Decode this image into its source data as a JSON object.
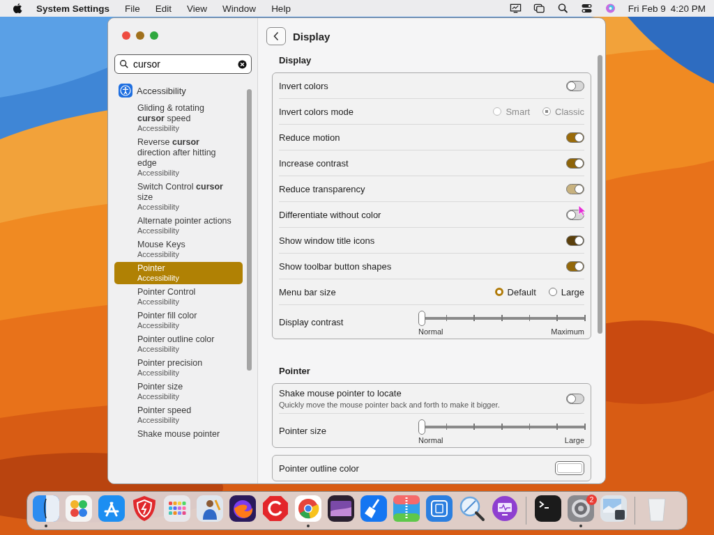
{
  "menu_bar": {
    "app": "System Settings",
    "menus": [
      "File",
      "Edit",
      "View",
      "Window",
      "Help"
    ],
    "date": "Fri Feb 9",
    "time": "4:20 PM"
  },
  "window": {
    "title": "Display",
    "search": {
      "value": "cursor"
    },
    "sidebar": {
      "items": [
        {
          "kind": "category",
          "title": "Accessibility",
          "selected": false
        },
        {
          "kind": "result",
          "title": "Gliding & rotating **cursor** speed",
          "subtitle": "Accessibility",
          "selected": false
        },
        {
          "kind": "result",
          "title": "Reverse **cursor** direction after hitting edge",
          "subtitle": "Accessibility",
          "selected": false
        },
        {
          "kind": "result",
          "title": "Switch Control **cursor** size",
          "subtitle": "Accessibility",
          "selected": false
        },
        {
          "kind": "result",
          "title": "Alternate pointer actions",
          "subtitle": "Accessibility",
          "selected": false
        },
        {
          "kind": "result",
          "title": "Mouse Keys",
          "subtitle": "Accessibility",
          "selected": false
        },
        {
          "kind": "result",
          "title": "Pointer",
          "subtitle": "Accessibility",
          "selected": true
        },
        {
          "kind": "result",
          "title": "Pointer Control",
          "subtitle": "Accessibility",
          "selected": false
        },
        {
          "kind": "result",
          "title": "Pointer fill color",
          "subtitle": "Accessibility",
          "selected": false
        },
        {
          "kind": "result",
          "title": "Pointer outline color",
          "subtitle": "Accessibility",
          "selected": false
        },
        {
          "kind": "result",
          "title": "Pointer precision",
          "subtitle": "Accessibility",
          "selected": false
        },
        {
          "kind": "result",
          "title": "Pointer size",
          "subtitle": "Accessibility",
          "selected": false
        },
        {
          "kind": "result",
          "title": "Pointer speed",
          "subtitle": "Accessibility",
          "selected": false
        },
        {
          "kind": "result",
          "title": "Shake mouse pointer",
          "selected": false
        }
      ]
    },
    "sections": [
      {
        "heading": "Display",
        "cards": [
          [
            {
              "kind": "toggle",
              "label": "Invert colors",
              "on": false
            },
            {
              "kind": "radio",
              "label": "Invert colors mode",
              "disabled": true,
              "options": [
                {
                  "label": "Smart",
                  "selected": false
                },
                {
                  "label": "Classic",
                  "selected": true
                }
              ]
            },
            {
              "kind": "toggle",
              "label": "Reduce motion",
              "on": true,
              "color": "#9a6b0a"
            },
            {
              "kind": "toggle",
              "label": "Increase contrast",
              "on": true,
              "color": "#8e6409"
            },
            {
              "kind": "toggle",
              "label": "Reduce transparency",
              "on": true,
              "color": "#c8b27f"
            },
            {
              "kind": "toggle",
              "label": "Differentiate without color",
              "on": false
            },
            {
              "kind": "toggle",
              "label": "Show window title icons",
              "on": true,
              "color": "#5b400c"
            },
            {
              "kind": "toggle",
              "label": "Show toolbar button shapes",
              "on": true,
              "color": "#93680a"
            },
            {
              "kind": "radio",
              "label": "Menu bar size",
              "disabled": false,
              "options": [
                {
                  "label": "Default",
                  "selected": true
                },
                {
                  "label": "Large",
                  "selected": false
                }
              ]
            },
            {
              "kind": "slider",
              "label": "Display contrast",
              "level": 0,
              "min_label": "Normal",
              "max_label": "Maximum"
            }
          ]
        ]
      },
      {
        "heading": "Pointer",
        "cards": [
          [
            {
              "kind": "toggle",
              "label": "Shake mouse pointer to locate",
              "description": "Quickly move the mouse pointer back and forth to make it bigger.",
              "on": false
            },
            {
              "kind": "slider",
              "label": "Pointer size",
              "level": 0,
              "min_label": "Normal",
              "max_label": "Large"
            }
          ],
          [
            {
              "kind": "color",
              "label": "Pointer outline color",
              "color": "#ffffff"
            }
          ]
        ]
      }
    ]
  },
  "dock": {
    "apps": [
      {
        "running": true
      },
      {
        "running": false
      },
      {
        "running": false
      },
      {
        "running": false
      },
      {
        "running": false
      },
      {
        "running": false
      },
      {
        "running": false
      },
      {
        "running": false
      },
      {
        "running": true
      },
      {
        "running": false
      },
      {
        "running": false
      },
      {
        "running": false
      },
      {
        "running": false
      },
      {
        "running": false
      },
      {
        "running": false
      },
      {
        "running": false
      },
      {
        "running": true,
        "badge": "2"
      },
      {
        "running": false
      },
      {
        "running": false
      }
    ]
  }
}
